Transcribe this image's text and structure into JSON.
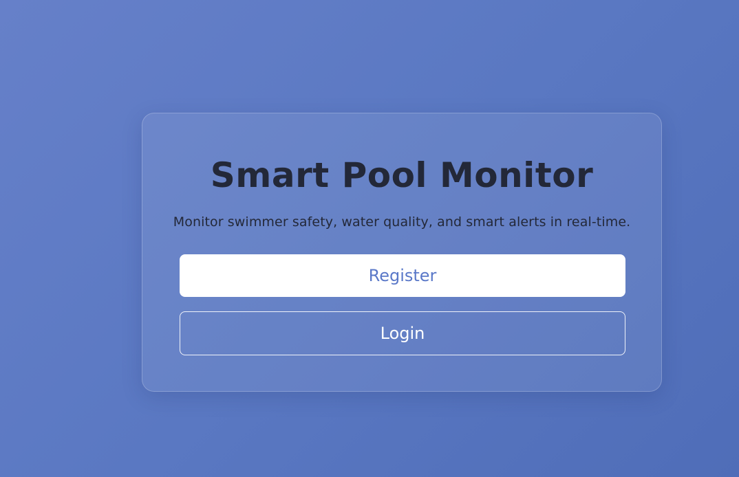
{
  "card": {
    "title": "Smart Pool Monitor",
    "subtitle": "Monitor swimmer safety, water quality, and smart alerts in real-time."
  },
  "actions": {
    "register_label": "Register",
    "login_label": "Login"
  },
  "colors": {
    "background": "#5a78c2",
    "title_text": "#232838",
    "register_text": "#5a78c8",
    "register_bg": "#ffffff",
    "login_text": "#ffffff"
  }
}
